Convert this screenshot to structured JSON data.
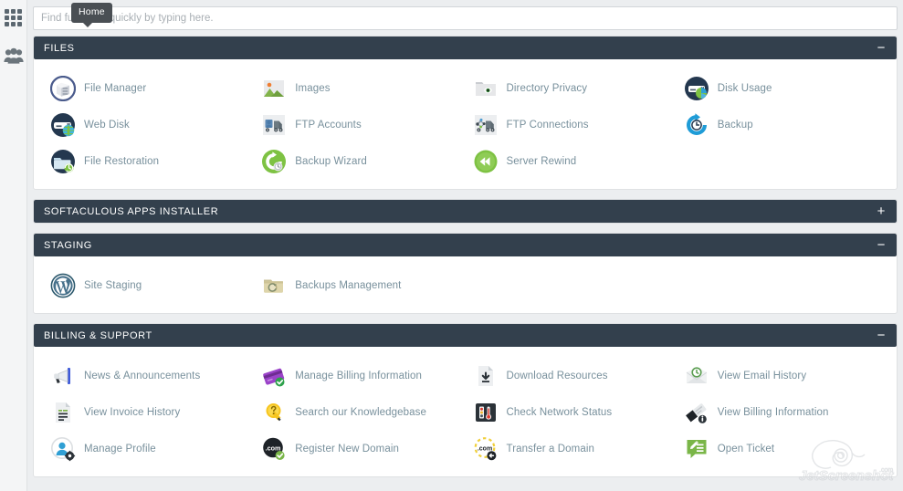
{
  "sidebar": {
    "items": [
      {
        "name": "apps-grid",
        "icon": "grid-icon",
        "tooltip": "Home"
      },
      {
        "name": "user-manager",
        "icon": "users-icon"
      }
    ]
  },
  "tooltip": {
    "text": "Home"
  },
  "search": {
    "placeholder": "Find functions quickly by typing here.",
    "value": ""
  },
  "sections": [
    {
      "id": "files",
      "title": "FILES",
      "collapsed": false,
      "toggle": "−",
      "items": [
        {
          "label": "File Manager",
          "icon": "file-manager-icon"
        },
        {
          "label": "Images",
          "icon": "images-icon"
        },
        {
          "label": "Directory Privacy",
          "icon": "directory-privacy-icon"
        },
        {
          "label": "Disk Usage",
          "icon": "disk-usage-icon"
        },
        {
          "label": "Web Disk",
          "icon": "web-disk-icon"
        },
        {
          "label": "FTP Accounts",
          "icon": "ftp-accounts-icon"
        },
        {
          "label": "FTP Connections",
          "icon": "ftp-connections-icon"
        },
        {
          "label": "Backup",
          "icon": "backup-icon"
        },
        {
          "label": "File Restoration",
          "icon": "file-restoration-icon"
        },
        {
          "label": "Backup Wizard",
          "icon": "backup-wizard-icon"
        },
        {
          "label": "Server Rewind",
          "icon": "server-rewind-icon"
        }
      ]
    },
    {
      "id": "softaculous",
      "title": "SOFTACULOUS APPS INSTALLER",
      "collapsed": true,
      "toggle": "+",
      "items": []
    },
    {
      "id": "staging",
      "title": "STAGING",
      "collapsed": false,
      "toggle": "−",
      "items": [
        {
          "label": "Site Staging",
          "icon": "wordpress-icon"
        },
        {
          "label": "Backups Management",
          "icon": "backups-folder-icon"
        }
      ]
    },
    {
      "id": "billing",
      "title": "BILLING & SUPPORT",
      "collapsed": false,
      "toggle": "−",
      "items": [
        {
          "label": "News & Announcements",
          "icon": "megaphone-icon"
        },
        {
          "label": "Manage Billing Information",
          "icon": "credit-card-icon"
        },
        {
          "label": "Download Resources",
          "icon": "download-file-icon"
        },
        {
          "label": "View Email History",
          "icon": "email-history-icon"
        },
        {
          "label": "View Invoice History",
          "icon": "invoice-icon"
        },
        {
          "label": "Search our Knowledgebase",
          "icon": "lightbulb-icon"
        },
        {
          "label": "Check Network Status",
          "icon": "network-status-icon"
        },
        {
          "label": "View Billing Information",
          "icon": "billing-info-icon"
        },
        {
          "label": "Manage Profile",
          "icon": "manage-profile-icon"
        },
        {
          "label": "Register New Domain",
          "icon": "register-domain-icon"
        },
        {
          "label": "Transfer a Domain",
          "icon": "transfer-domain-icon"
        },
        {
          "label": "Open Ticket",
          "icon": "open-ticket-icon"
        }
      ]
    }
  ],
  "watermark": {
    "text": "JetScreenshot.com"
  },
  "colors": {
    "header_bg": "#33404d",
    "page_bg": "#eceef0",
    "label": "#78909c",
    "accent_blue": "#1f9cd7",
    "accent_green": "#74b644"
  }
}
